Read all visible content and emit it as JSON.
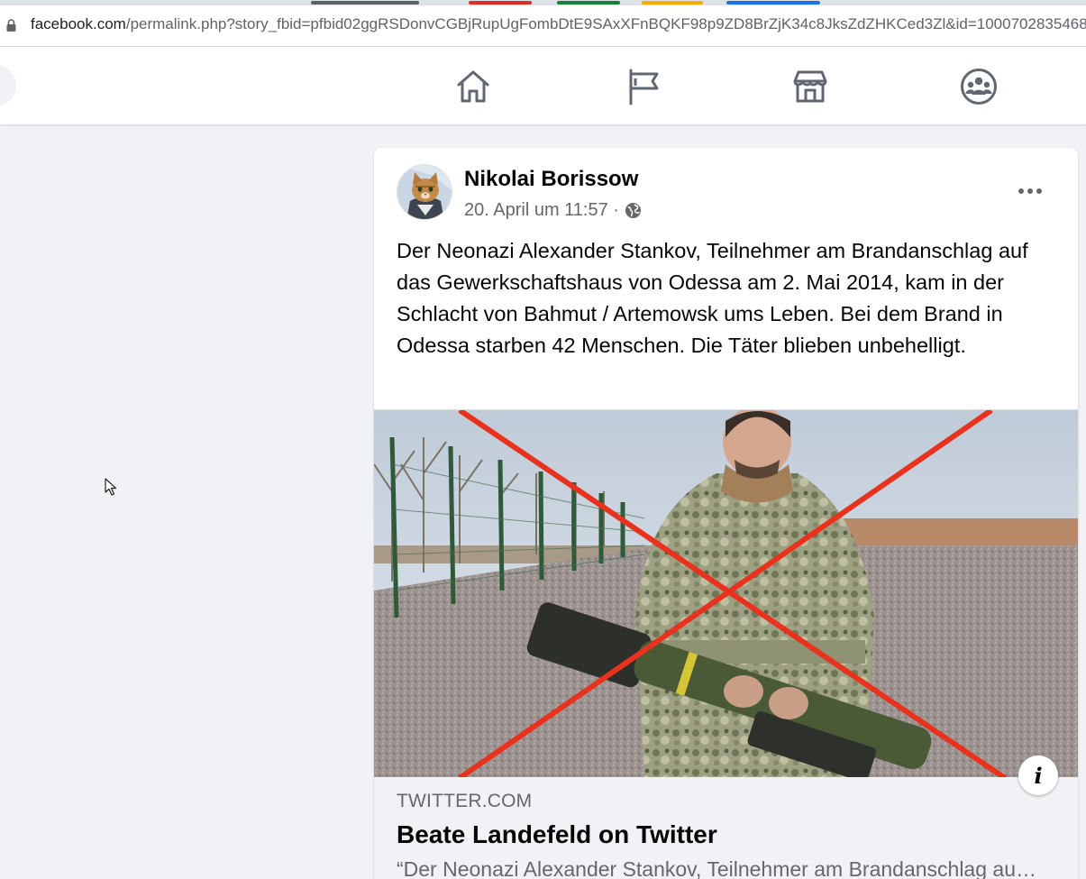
{
  "browser": {
    "url_host": "facebook.com",
    "url_path": "/permalink.php?story_fbid=pfbid02ggRSDonvCGBjRupUgFombDtE9SAxXFnBQKF98p9ZD8BrZjK34c8JksZdZHKCed3Zl&id=1000702835468",
    "lock_icon": "lock-icon"
  },
  "nav": {
    "icons": [
      "home-icon",
      "flag-icon",
      "marketplace-icon",
      "groups-icon"
    ]
  },
  "post": {
    "author": "Nikolai Borissow",
    "timestamp": "20. April um 11:57 ·",
    "privacy_icon": "globe-icon",
    "text": "Der Neonazi Alexander Stankov, Teilnehmer am Brandanschlag auf das Gewerkschaftshaus von Odessa am 2. Mai 2014, kam in der Schlacht von Bahmut / Artemowsk ums Leben. Bei dem Brand in Odessa starben 42 Menschen. Die Täter blieben unbehelligt.",
    "link": {
      "domain": "TWITTER.COM",
      "title": "Beate Landefeld on Twitter",
      "description": "“Der Neonazi Alexander Stankov, Teilnehmer am Brandanschlag auf das Gewerkschaftshaus von Odessa"
    }
  },
  "colors": {
    "page_bg": "#f0f2f5",
    "card_bg": "#ffffff",
    "secondary_text": "#65676b",
    "cross_red": "#e8321e"
  }
}
